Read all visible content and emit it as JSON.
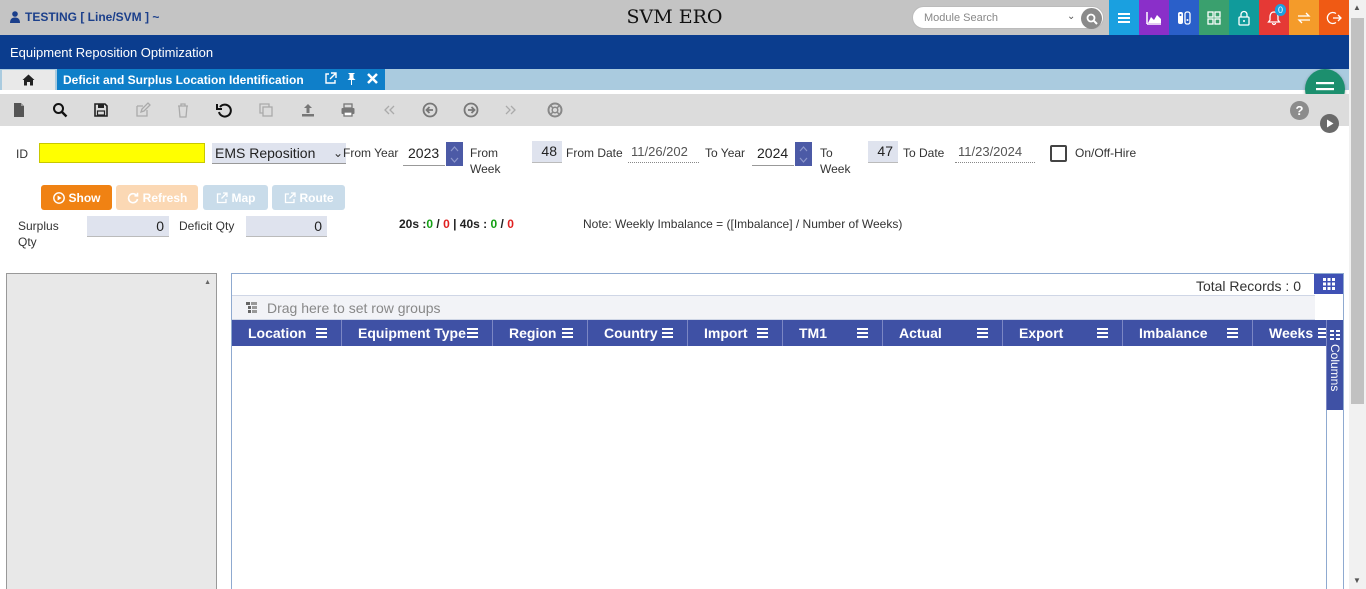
{
  "topbar": {
    "user": "TESTING [ Line/SVM ] ~",
    "app_title": "SVM ERO",
    "search_placeholder": "Module Search",
    "notification_count": "0",
    "colors": [
      "#1aa0e0",
      "#8a2fc9",
      "#2a5fc9",
      "#3aa06e",
      "#109b9b",
      "#e53935",
      "#f49b2a",
      "#f05a14"
    ]
  },
  "banner": {
    "title": "Equipment Reposition Optimization"
  },
  "tabs": {
    "active_label": "Deficit and Surplus Location Identification"
  },
  "form": {
    "id_label": "ID",
    "id_value": "",
    "type_value": "EMS Reposition",
    "from_year_label": "From Year",
    "from_year": "2023",
    "from_week_label": "From Week",
    "from_week": "48",
    "from_date_label": "From Date",
    "from_date": "11/26/202",
    "to_year_label": "To Year",
    "to_year": "2024",
    "to_week_label": "To Week",
    "to_week": "47",
    "to_date_label": "To Date",
    "to_date": "11/23/2024",
    "onoff_label": "On/Off-Hire",
    "surplus_label": "Surplus Qty",
    "surplus_value": "0",
    "deficit_label": "Deficit Qty",
    "deficit_value": "0",
    "counts": {
      "t20_label": "20s :",
      "t20_a": "0",
      "t20_b": "0",
      "t40_label": "| 40s :",
      "t40_a": "0",
      "t40_b": "0"
    },
    "note": "Note: Weekly Imbalance = ([Imbalance] / Number of Weeks)"
  },
  "buttons": {
    "show": "Show",
    "refresh": "Refresh",
    "map": "Map",
    "route": "Route"
  },
  "grid": {
    "total_records": "Total Records : 0",
    "group_hint": "Drag here to set row groups",
    "columns": [
      "Location",
      "Equipment Type",
      "Region",
      "Country",
      "Import",
      "TM1",
      "Actual",
      "Export",
      "Imbalance",
      "Weeks"
    ],
    "side_label": "Columns"
  }
}
